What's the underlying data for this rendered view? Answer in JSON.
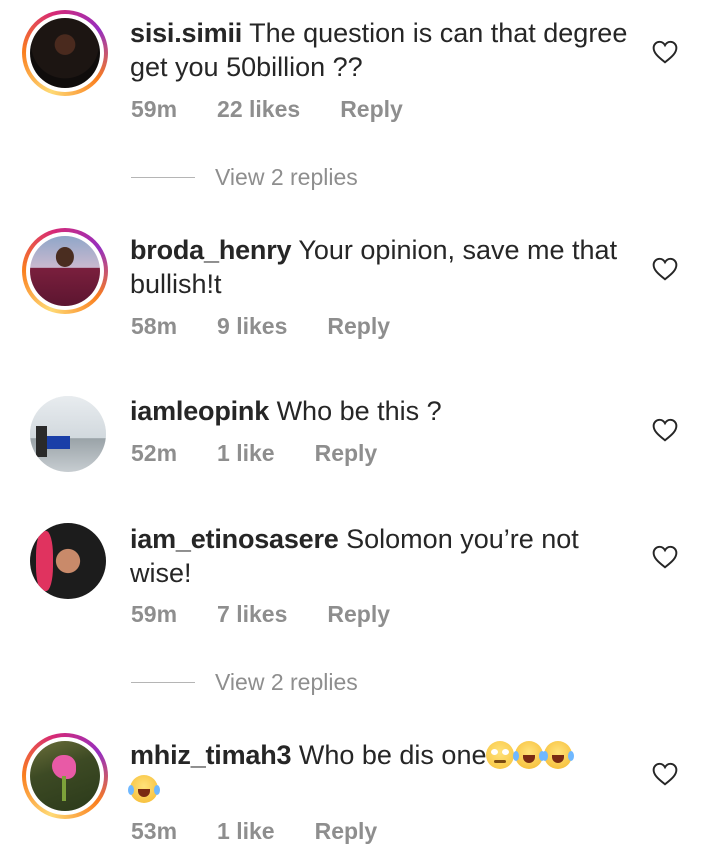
{
  "comments": [
    {
      "username": "sisi.simii",
      "text": "The question is can that degree get you 50billion ??",
      "time": "59m",
      "likes": "22 likes",
      "reply": "Reply",
      "has_story_ring": true
    },
    {
      "username": "broda_henry",
      "text": "Your opinion, save me that bullish!t",
      "time": "58m",
      "likes": "9 likes",
      "reply": "Reply",
      "has_story_ring": true
    },
    {
      "username": "iamleopink",
      "text": "Who be this ?",
      "time": "52m",
      "likes": "1 like",
      "reply": "Reply",
      "has_story_ring": false
    },
    {
      "username": "iam_etinosasere",
      "text": "Solomon you’re not wise!",
      "time": "59m",
      "likes": "7 likes",
      "reply": "Reply",
      "has_story_ring": false
    },
    {
      "username": "mhiz_timah3",
      "text": "Who be dis one",
      "emojis": [
        "face-with-rolling-eyes",
        "face-with-tears-of-joy",
        "face-with-tears-of-joy",
        "face-with-tears-of-joy"
      ],
      "time": "53m",
      "likes": "1 like",
      "reply": "Reply",
      "has_story_ring": true
    }
  ],
  "view_replies": [
    {
      "label": "View 2 replies"
    },
    {
      "label": "View 2 replies"
    }
  ],
  "icons": {
    "like": "heart-outline-icon"
  },
  "colors": {
    "text": "#262626",
    "meta": "#8e8e8e",
    "divider": "#b5b5b5"
  }
}
